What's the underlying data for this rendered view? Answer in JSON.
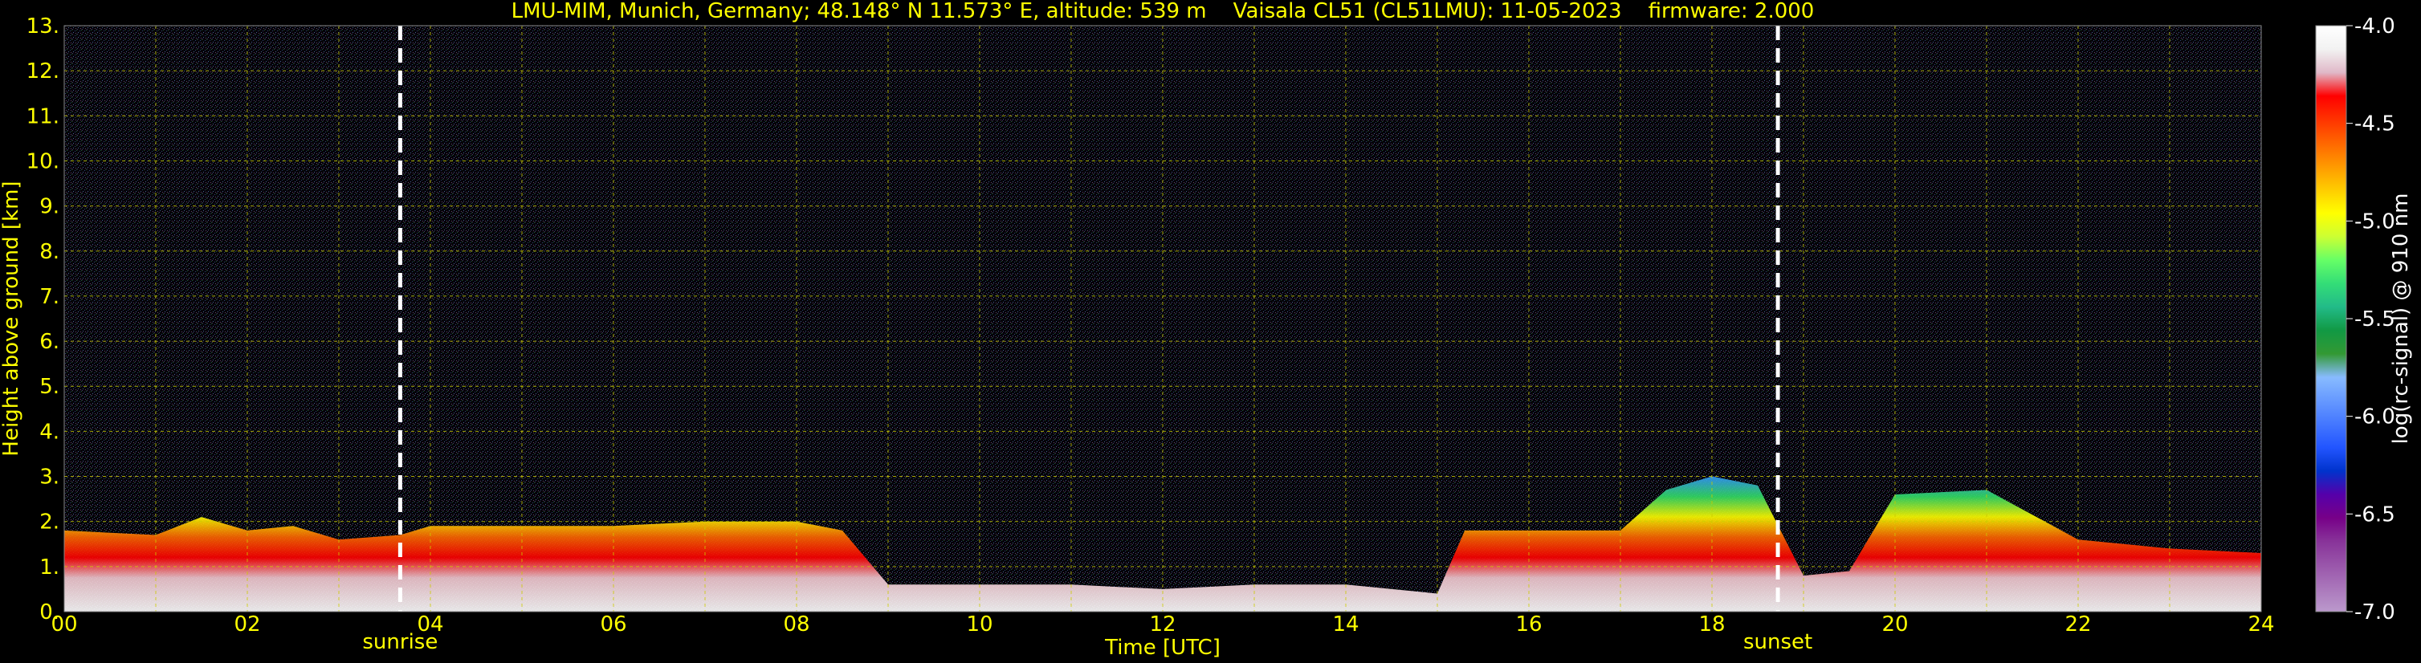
{
  "chart_data": {
    "type": "heatmap",
    "title": "LMU-MIM, Munich, Germany; 48.148° N 11.573° E, altitude: 539 m    Vaisala CL51 (CL51LMU): 11-05-2023    firmware: 2.000",
    "xlabel": "Time [UTC]",
    "ylabel": "Height above ground [km]",
    "xlim": [
      0,
      24
    ],
    "ylim": [
      0,
      13
    ],
    "x_tick_labels": [
      "00",
      "02",
      "04",
      "06",
      "08",
      "10",
      "12",
      "14",
      "16",
      "18",
      "20",
      "22",
      "24"
    ],
    "y_tick_labels": [
      "0.",
      "1.",
      "2.",
      "3.",
      "4.",
      "5.",
      "6.",
      "7.",
      "8.",
      "9.",
      "10.",
      "11.",
      "12.",
      "13."
    ],
    "grid": true,
    "colorbar": {
      "label": "log(rc-signal) @ 910 nm",
      "range": [
        -7.0,
        -4.0
      ],
      "tick_labels": [
        "-4.0",
        "-4.5",
        "-5.0",
        "-5.5",
        "-6.0",
        "-6.5",
        "-7.0"
      ],
      "tick_values": [
        -4.0,
        -4.5,
        -5.0,
        -5.5,
        -6.0,
        -6.5,
        -7.0
      ],
      "colors": [
        "#ffffff",
        "#f2f2f2",
        "#e0b8c8",
        "#ff0000",
        "#ff3300",
        "#ff6600",
        "#ff9900",
        "#ffcc00",
        "#ffff00",
        "#ccff33",
        "#66ff66",
        "#33dd77",
        "#22bb88",
        "#119944",
        "#339933",
        "#88bbff",
        "#6699ff",
        "#4477ff",
        "#2255ff",
        "#0033cc",
        "#5500aa",
        "#770088",
        "#883399",
        "#9955aa",
        "#aa77bb",
        "#bb99cc"
      ]
    },
    "annotations": [
      {
        "text": "sunrise",
        "x": 3.67
      },
      {
        "text": "sunset",
        "x": 18.72
      }
    ],
    "boundary_layer": {
      "description_hours": [
        0,
        1,
        1.5,
        2,
        2.5,
        3,
        3.67,
        4,
        5,
        6,
        7,
        8,
        8.5,
        9,
        10,
        11,
        12,
        13,
        14,
        15,
        15.3,
        16,
        17,
        17.5,
        18,
        18.5,
        19,
        19.5,
        20,
        21,
        22,
        23,
        24
      ],
      "top_km": [
        1.8,
        1.7,
        2.1,
        1.8,
        1.9,
        1.6,
        1.7,
        1.9,
        1.9,
        1.9,
        2.0,
        2.0,
        1.8,
        0.6,
        0.6,
        0.6,
        0.5,
        0.6,
        0.6,
        0.4,
        1.8,
        1.8,
        1.8,
        2.7,
        3.0,
        2.8,
        0.8,
        0.9,
        2.6,
        2.7,
        1.6,
        1.4,
        1.3
      ]
    }
  }
}
